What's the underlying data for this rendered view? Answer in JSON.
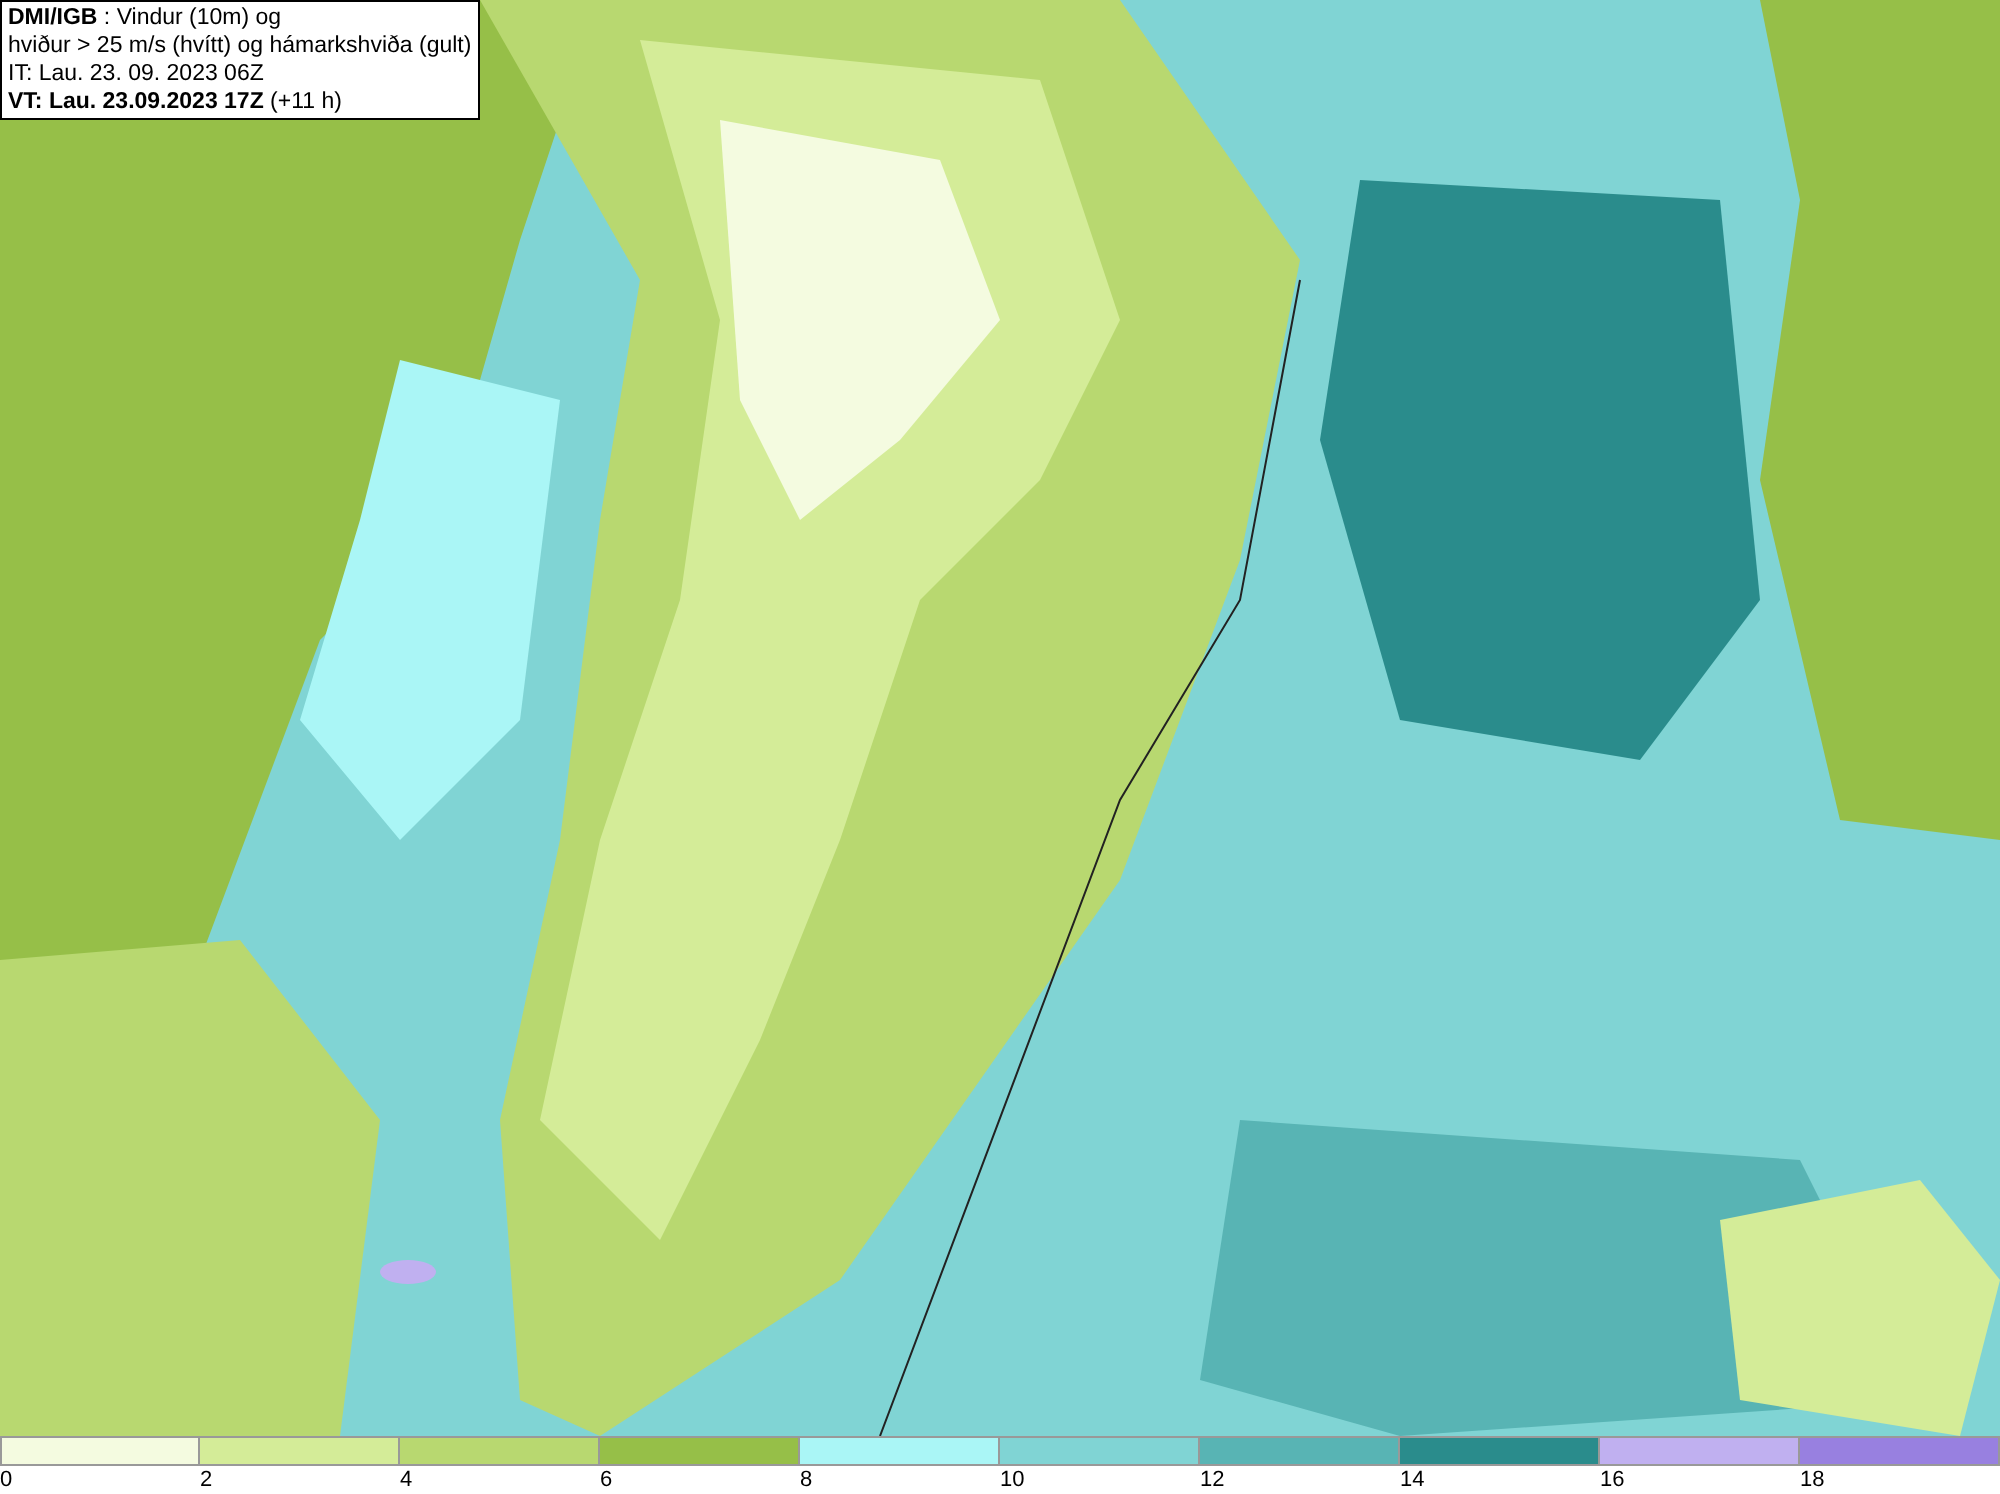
{
  "header": {
    "lines": [
      "**DMI/IGB** : Vindur (10m) og",
      "hviður > 25 m/s (hvítt) og hámarkshviða (gult)",
      "IT: Lau. 23. 09. 2023 06Z",
      "**VT: Lau. 23.09.2023 17Z** (+11 h)"
    ]
  },
  "legend": [
    {
      "label": "0",
      "color": "#f4fbe0"
    },
    {
      "label": "2",
      "color": "#d4ec98"
    },
    {
      "label": "4",
      "color": "#b8d870"
    },
    {
      "label": "6",
      "color": "#96bf48"
    },
    {
      "label": "8",
      "color": "#aaf6f6"
    },
    {
      "label": "10",
      "color": "#80d4d4"
    },
    {
      "label": "12",
      "color": "#58b4b4"
    },
    {
      "label": "14",
      "color": "#2a8c8c"
    },
    {
      "label": "16",
      "color": "#c0b0f0"
    },
    {
      "label": "18",
      "color": "#9880e0"
    }
  ]
}
